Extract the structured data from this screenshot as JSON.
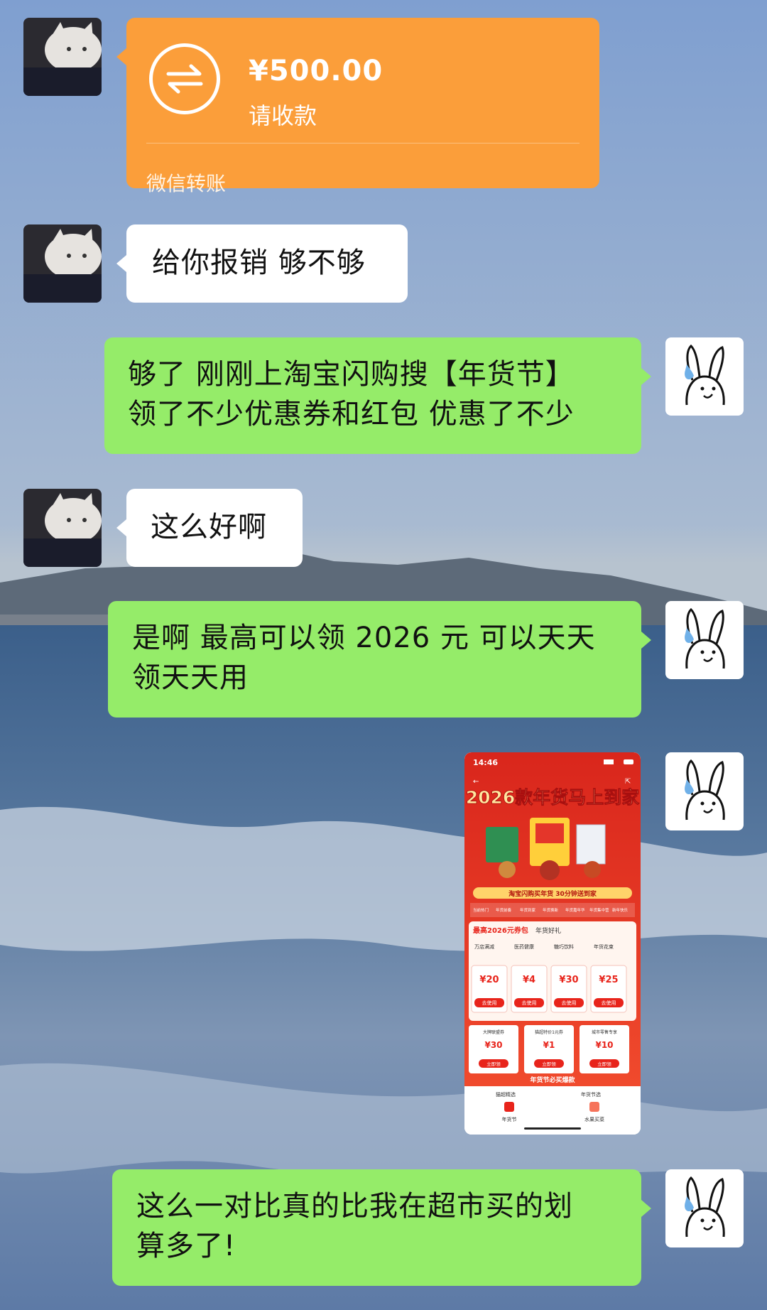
{
  "transfer": {
    "amount": "¥500.00",
    "status": "请收款",
    "footer": "微信转账",
    "icon": "transfer-arrows-icon",
    "color": "#fb9e3a"
  },
  "messages": [
    {
      "side": "in",
      "text": "给你报销 够不够"
    },
    {
      "side": "out",
      "lines": [
        "够了 刚刚上淘宝闪购搜【年货节】",
        "领了不少优惠券和红包 优惠了不少"
      ]
    },
    {
      "side": "in",
      "text": "这么好啊"
    },
    {
      "side": "out",
      "lines": [
        "是啊 最高可以领 2026 元 可以天天",
        "领天天用"
      ]
    },
    {
      "side": "out",
      "lines": [
        "这么一对比真的比我在超市买的划",
        "算多了!"
      ]
    }
  ],
  "screenshot": {
    "time": "14:46",
    "banner": "2026款年货马上到家",
    "strip": "淘宝闪购买年货 30分钟送到家",
    "tabs": [
      "当前热门",
      "年货前奏",
      "年货到家",
      "年货换新",
      "年货嘉年华",
      "年货集中营",
      "新年快乐"
    ],
    "coupon_title": "最高2026元券包",
    "coupon_sub": "年货好礼",
    "coupon_cats": [
      "万店满减",
      "医药健康",
      "糖巧饮料",
      "年货花束"
    ],
    "coupons": [
      {
        "value": "¥20",
        "btn": "去使用"
      },
      {
        "value": "¥4",
        "btn": "去使用"
      },
      {
        "value": "¥30",
        "btn": "去使用"
      },
      {
        "value": "¥25",
        "btn": "去使用"
      }
    ],
    "cards": [
      {
        "title": "大牌联盟券",
        "value": "¥30",
        "btn": "立即领"
      },
      {
        "title": "猫超特价1元券",
        "value": "¥1",
        "btn": "立即领"
      },
      {
        "title": "城市零售专享",
        "value": "¥10",
        "btn": "立即领"
      }
    ],
    "hot": "年货节必买爆款",
    "bottom_tabs": [
      "猫超精选",
      "年货节",
      "年货节选",
      "水果买菜"
    ]
  },
  "colors": {
    "out_bubble": "#95ec69",
    "in_bubble": "#ffffff",
    "red": "#e8241b",
    "gold": "#ffd36a"
  }
}
